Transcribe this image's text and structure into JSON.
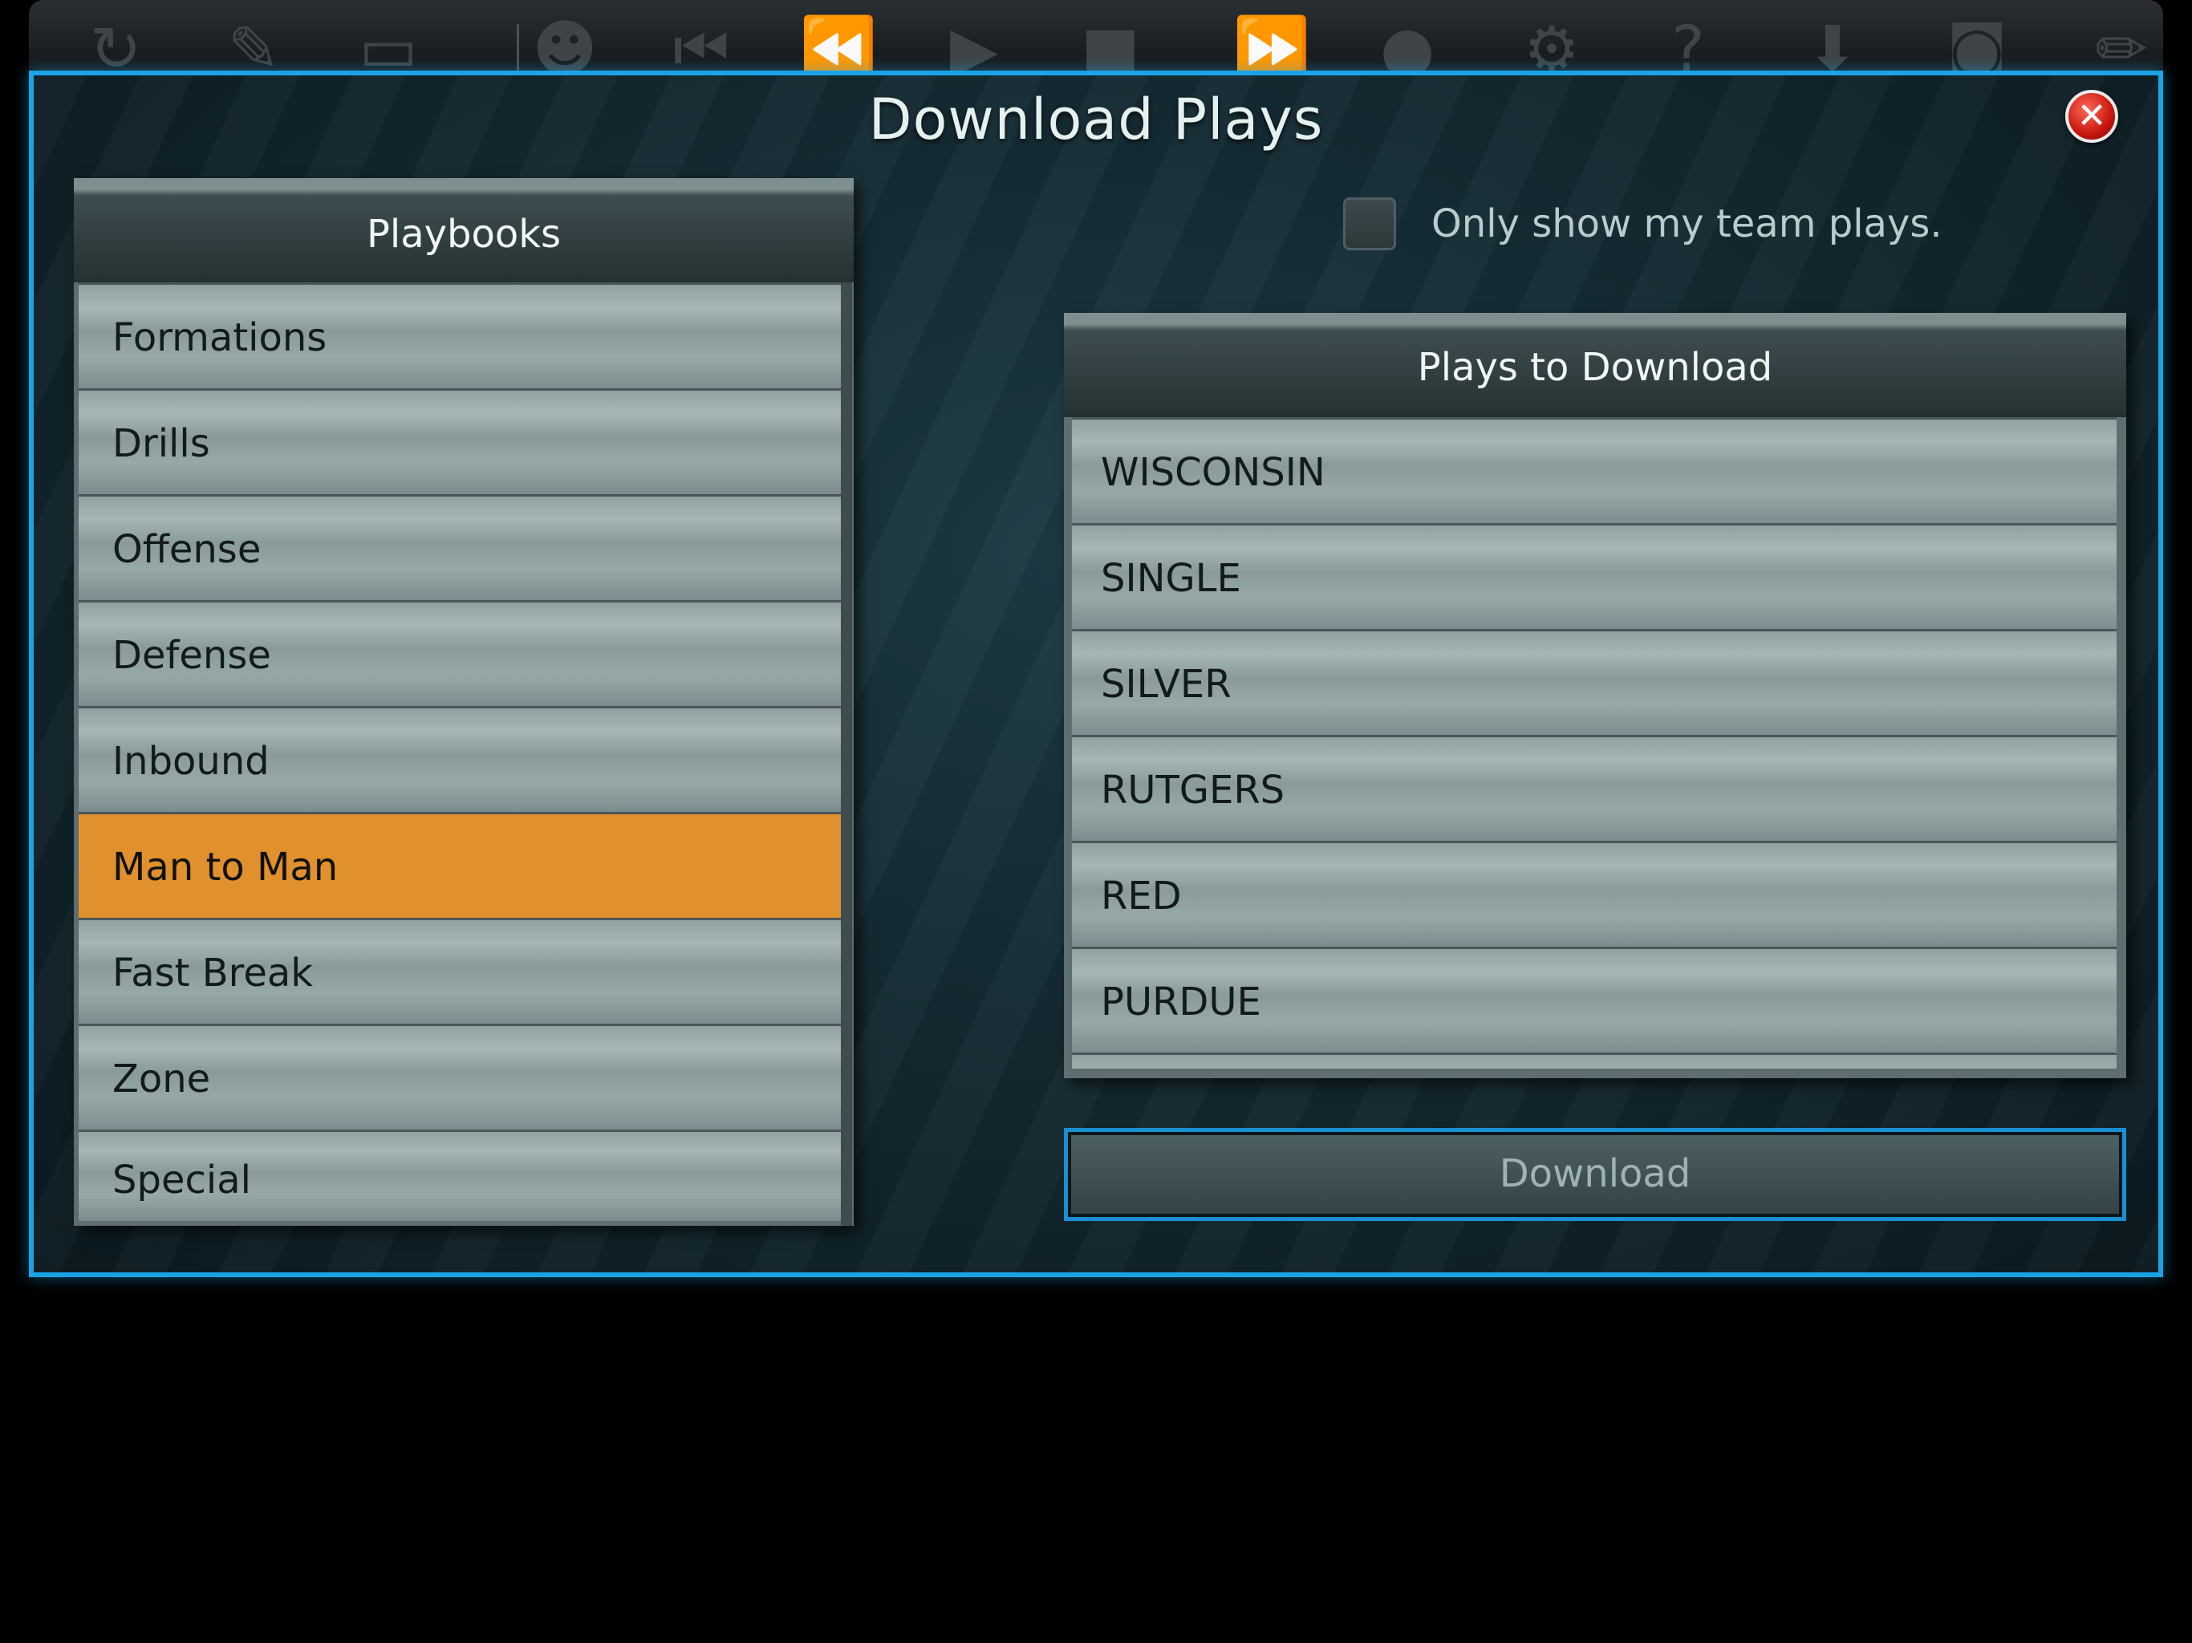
{
  "toolbar": {
    "icons": [
      "refresh-icon",
      "edit-document-icon",
      "save-icon",
      "team-icon",
      "skip-back-icon",
      "rewind-icon",
      "play-icon",
      "stop-icon",
      "fast-forward-icon",
      "record-icon",
      "settings-icon",
      "help-icon",
      "download-icon",
      "camera-icon",
      "pencil-icon"
    ]
  },
  "dialog": {
    "title": "Download Plays",
    "close_icon": "close-icon",
    "close_label": "✕"
  },
  "playbooks": {
    "header": "Playbooks",
    "selected_index": 5,
    "items": [
      "Formations",
      "Drills",
      "Offense",
      "Defense",
      "Inbound",
      "Man to Man",
      "Fast Break",
      "Zone",
      "Special"
    ]
  },
  "filter": {
    "checked": false,
    "label": "Only show my team plays."
  },
  "plays": {
    "header": "Plays to Download",
    "items": [
      "WISCONSIN",
      "SINGLE",
      "SILVER",
      "RUTGERS",
      "RED",
      "PURDUE"
    ]
  },
  "download_button": {
    "label": "Download"
  },
  "colors": {
    "accent_border": "#1ba3e8",
    "selected_row": "#e0902d",
    "close_button": "#c8160e"
  }
}
